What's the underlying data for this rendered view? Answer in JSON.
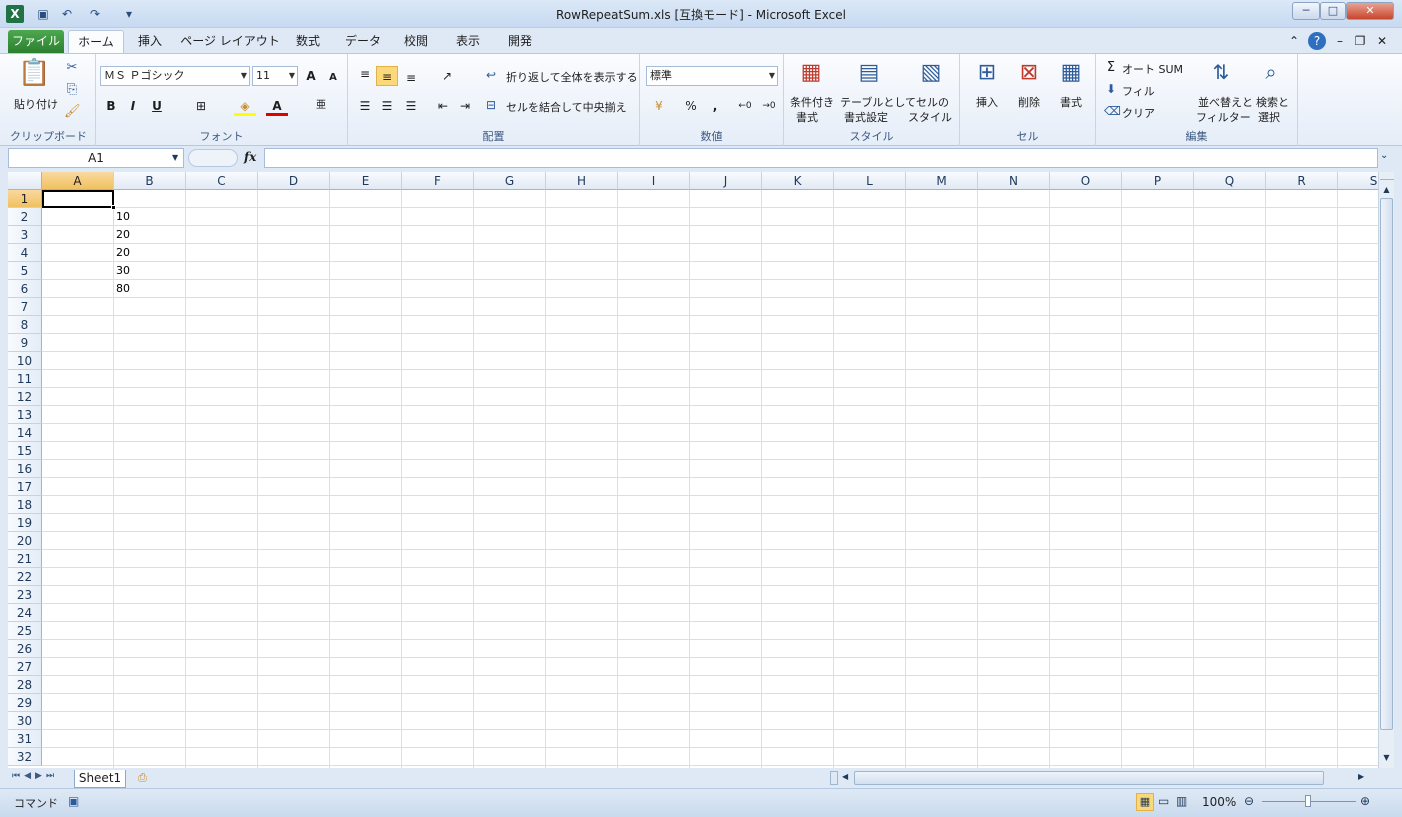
{
  "window": {
    "title": "RowRepeatSum.xls  [互換モード] - Microsoft Excel"
  },
  "quick_access": {
    "undo": "↶",
    "redo": "↷",
    "customize": "▾"
  },
  "tabs": [
    {
      "label": "ファイル"
    },
    {
      "label": "ホーム"
    },
    {
      "label": "挿入"
    },
    {
      "label": "ページ レイアウト"
    },
    {
      "label": "数式"
    },
    {
      "label": "データ"
    },
    {
      "label": "校閲"
    },
    {
      "label": "表示"
    },
    {
      "label": "開発"
    }
  ],
  "ribbon": {
    "clipboard": {
      "paste": "貼り付け",
      "label": "クリップボード"
    },
    "font": {
      "name": "ＭＳ Ｐゴシック",
      "size": "11",
      "label": "フォント",
      "bold": "B",
      "italic": "I",
      "underline": "U"
    },
    "alignment": {
      "wrap": "折り返して全体を表示する",
      "merge": "セルを結合して中央揃え",
      "label": "配置"
    },
    "number": {
      "format": "標準",
      "percent": "%",
      "comma": ",",
      "label": "数値"
    },
    "styles": {
      "cond1": "条件付き",
      "cond2": "書式",
      "table1": "テーブルとして",
      "table2": "書式設定",
      "cell1": "セルの",
      "cell2": "スタイル",
      "label": "スタイル"
    },
    "cells": {
      "insert": "挿入",
      "delete": "削除",
      "format": "書式",
      "label": "セル"
    },
    "editing": {
      "autosum": "オート SUM",
      "fill": "フィル",
      "clear": "クリア",
      "sort1": "並べ替えと",
      "sort2": "フィルター",
      "find1": "検索と",
      "find2": "選択",
      "label": "編集"
    }
  },
  "formula_bar": {
    "name_box": "A1",
    "fx": "fx",
    "content": ""
  },
  "columns": [
    "A",
    "B",
    "C",
    "D",
    "E",
    "F",
    "G",
    "H",
    "I",
    "J",
    "K",
    "L",
    "M",
    "N",
    "O",
    "P",
    "Q",
    "R",
    "S"
  ],
  "rows": [
    "1",
    "2",
    "3",
    "4",
    "5",
    "6",
    "7",
    "8",
    "9",
    "10",
    "11",
    "12",
    "13",
    "14",
    "15",
    "16",
    "17",
    "18",
    "19",
    "20",
    "21",
    "22",
    "23",
    "24",
    "25",
    "26",
    "27",
    "28",
    "29",
    "30",
    "31",
    "32"
  ],
  "cells": [
    {
      "ref": "B2",
      "value": "10"
    },
    {
      "ref": "B3",
      "value": "20"
    },
    {
      "ref": "B4",
      "value": "20"
    },
    {
      "ref": "B5",
      "value": "30"
    },
    {
      "ref": "B6",
      "value": "80"
    }
  ],
  "sheets": [
    {
      "name": "Sheet1"
    }
  ],
  "status": {
    "mode": "コマンド",
    "zoom": "100%"
  }
}
